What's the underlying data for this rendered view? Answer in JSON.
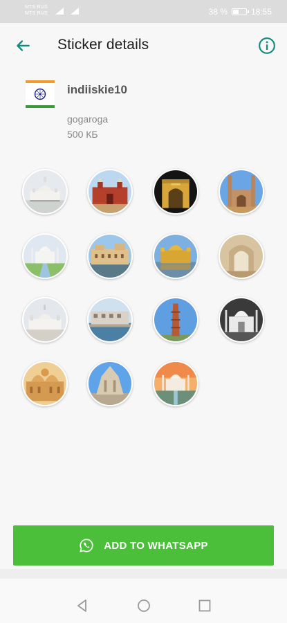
{
  "status_bar": {
    "carrier_1": "MTS RUS",
    "carrier_2": "MTS RUS",
    "battery_text": "38 %",
    "battery_level": 0.38,
    "time": "18:55"
  },
  "app_bar": {
    "title": "Sticker details",
    "back_icon": "arrow-left-icon",
    "info_icon": "info-circle-icon",
    "accent": "#128c7e"
  },
  "pack": {
    "name": "indiiskie10",
    "author": "gogaroga",
    "size": "500 КБ"
  },
  "stickers": [
    {
      "name": "Victoria Memorial"
    },
    {
      "name": "Red Fort"
    },
    {
      "name": "India Gate"
    },
    {
      "name": "Charminar"
    },
    {
      "name": "Taj Mahal garden"
    },
    {
      "name": "Palace on lake"
    },
    {
      "name": "Golden Temple"
    },
    {
      "name": "Fatehpur Sikri arch"
    },
    {
      "name": "Victoria Memorial white"
    },
    {
      "name": "Ghats of Varanasi"
    },
    {
      "name": "Qutub Minar"
    },
    {
      "name": "Taj Mahal night"
    },
    {
      "name": "Akshardham"
    },
    {
      "name": "Temple carvings"
    },
    {
      "name": "Taj Mahal sunset"
    }
  ],
  "add_button": {
    "label": "ADD TO WHATSAPP",
    "color": "#4cbf3a"
  },
  "nav": {
    "back": "triangle-back-icon",
    "home": "circle-home-icon",
    "recents": "square-recents-icon"
  }
}
